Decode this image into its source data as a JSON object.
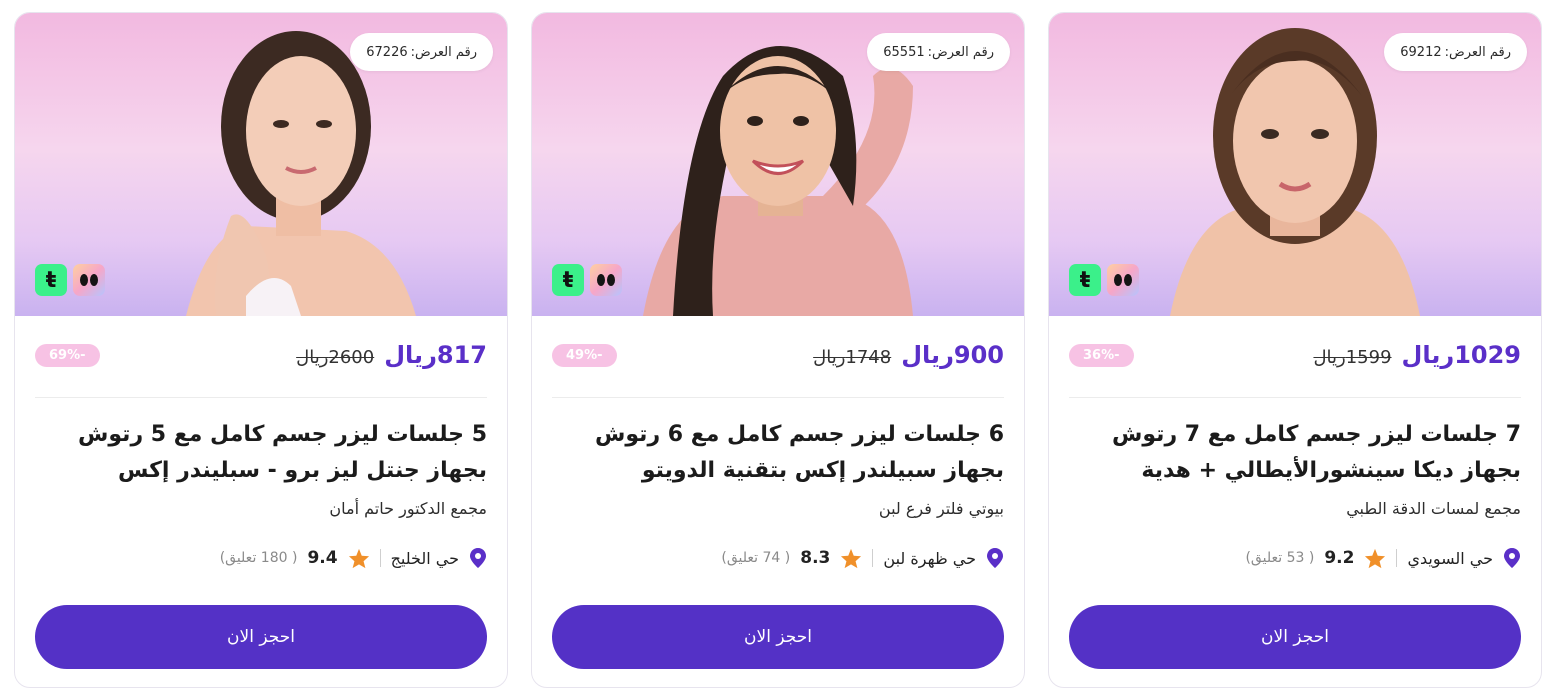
{
  "offer_label": "رقم العرض:",
  "currency": "ريال",
  "book_label": "احجز الان",
  "reviews_word": "تعليق",
  "colors": {
    "accent": "#5431c6",
    "price": "#5a2fc8",
    "discount_bg": "#f7c2e4",
    "star": "#f0902a",
    "pin": "#5a2fc8"
  },
  "icons": [
    "location-pin-icon",
    "star-icon",
    "tabby-icon",
    "tamara-icon"
  ],
  "cards": [
    {
      "offer_id": "69212",
      "price_new": "1029ريال",
      "price_old": "1599ريال",
      "discount": "-36%",
      "title": "7 جلسات ليزر جسم كامل مع 7 رتوش بجهاز ديكا سينشورالأيطالي + هدية",
      "provider": "مجمع لمسات الدقة الطبي",
      "location": "حي السويدي",
      "rating": "9.2",
      "reviews": "( 53 تعليق)"
    },
    {
      "offer_id": "65551",
      "price_new": "900ريال",
      "price_old": "1748ريال",
      "discount": "-49%",
      "title": "6 جلسات ليزر جسم كامل مع 6 رتوش بجهاز سبيلندر إكس بتقنية الدويتو",
      "provider": "بيوتي فلتر فرع لبن",
      "location": "حي ظهرة لبن",
      "rating": "8.3",
      "reviews": "( 74 تعليق)"
    },
    {
      "offer_id": "67226",
      "price_new": "817ريال",
      "price_old": "2600ريال",
      "discount": "-69%",
      "title": "5 جلسات ليزر جسم كامل مع 5 رتوش بجهاز جنتل ليز برو - سبليندر إكس",
      "provider": "مجمع الدكتور حاتم أمان",
      "location": "حي الخليج",
      "rating": "9.4",
      "reviews": "( 180 تعليق)"
    }
  ]
}
